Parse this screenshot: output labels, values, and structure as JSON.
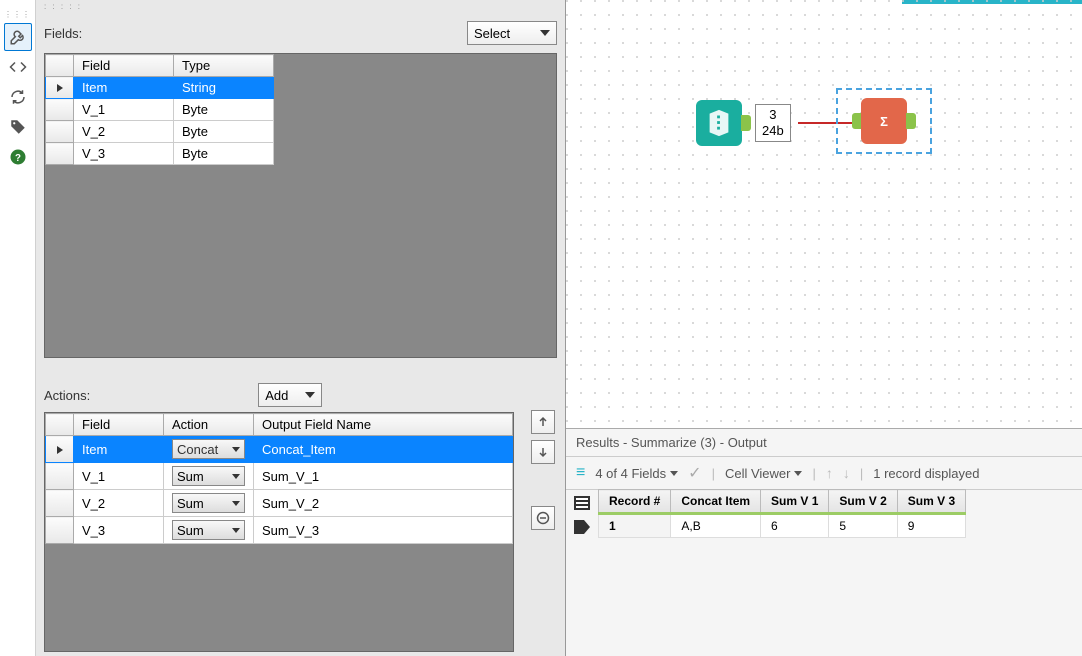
{
  "toolbar": {
    "icons": [
      "wrench-icon",
      "code-icon",
      "refresh-icon",
      "tag-icon",
      "help-icon"
    ]
  },
  "fields_section": {
    "label": "Fields:",
    "select_button": "Select",
    "columns": [
      "Field",
      "Type"
    ],
    "rows": [
      {
        "field": "Item",
        "type": "String",
        "selected": true
      },
      {
        "field": "V_1",
        "type": "Byte",
        "selected": false
      },
      {
        "field": "V_2",
        "type": "Byte",
        "selected": false
      },
      {
        "field": "V_3",
        "type": "Byte",
        "selected": false
      }
    ]
  },
  "actions_section": {
    "label": "Actions:",
    "add_button": "Add",
    "columns": [
      "Field",
      "Action",
      "Output Field Name"
    ],
    "rows": [
      {
        "field": "Item",
        "action": "Concat",
        "output": "Concat_Item",
        "selected": true
      },
      {
        "field": "V_1",
        "action": "Sum",
        "output": "Sum_V_1",
        "selected": false
      },
      {
        "field": "V_2",
        "action": "Sum",
        "output": "Sum_V_2",
        "selected": false
      },
      {
        "field": "V_3",
        "action": "Sum",
        "output": "Sum_V_3",
        "selected": false
      }
    ]
  },
  "canvas": {
    "record_count": "3",
    "record_size": "24b",
    "sigma": "Σ"
  },
  "results": {
    "title": "Results - Summarize (3) - Output",
    "fields_info": "4 of 4 Fields",
    "cell_viewer": "Cell Viewer",
    "record_info": "1 record displayed",
    "columns": [
      "Record #",
      "Concat Item",
      "Sum V 1",
      "Sum V 2",
      "Sum V 3"
    ],
    "rows": [
      {
        "rec": "1",
        "c1": "A,B",
        "c2": "6",
        "c3": "5",
        "c4": "9"
      }
    ]
  }
}
